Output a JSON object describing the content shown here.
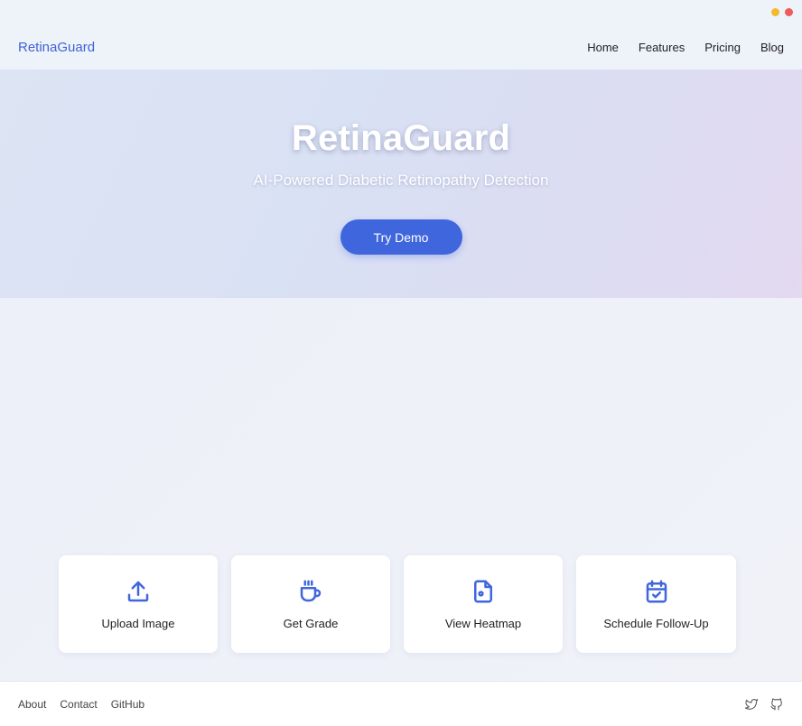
{
  "brand": "RetinaGuard",
  "nav": {
    "home": "Home",
    "features": "Features",
    "pricing": "Pricing",
    "blog": "Blog"
  },
  "hero": {
    "title": "RetinaGuard",
    "subtitle": "AI-Powered Diabetic Retinopathy Detection",
    "cta_label": "Try Demo"
  },
  "cards": [
    {
      "label": "Upload Image",
      "icon": "upload-icon"
    },
    {
      "label": "Get Grade",
      "icon": "coffee-icon"
    },
    {
      "label": "View Heatmap",
      "icon": "file-icon"
    },
    {
      "label": "Schedule Follow-Up",
      "icon": "calendar-check-icon"
    }
  ],
  "footer": {
    "about": "About",
    "contact": "Contact",
    "github": "GitHub",
    "social_icons": [
      "twitter-icon",
      "github-icon"
    ]
  },
  "colors": {
    "accent": "#4066dd",
    "window_minimize": "#f5b92e",
    "window_close": "#ef5a5a"
  }
}
